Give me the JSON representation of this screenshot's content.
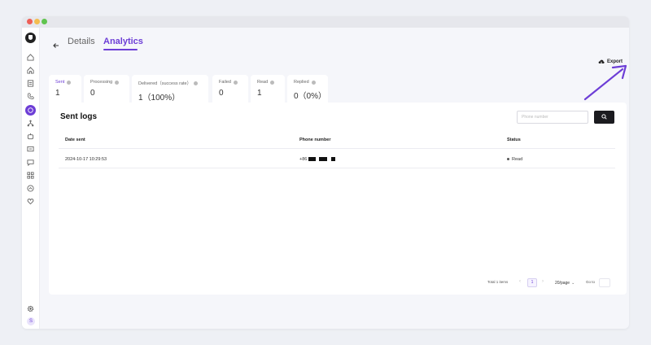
{
  "header": {
    "tab_details": "Details",
    "tab_analytics": "Analytics",
    "export_label": "Export"
  },
  "stats": [
    {
      "label": "Sent",
      "value": "1"
    },
    {
      "label": "Processing",
      "value": "0"
    },
    {
      "label": "Delivered（success rate）",
      "value": "1（100%）"
    },
    {
      "label": "Failed",
      "value": "0"
    },
    {
      "label": "Read",
      "value": "1"
    },
    {
      "label": "Replied",
      "value": "0（0%）"
    }
  ],
  "logs": {
    "title": "Sent logs",
    "search_placeholder": "Phone number",
    "columns": [
      "Date sent",
      "Phone number",
      "Status"
    ],
    "rows": [
      {
        "date": "2024-10-17 10:29:53",
        "phone": "+86",
        "status": "Read"
      }
    ]
  },
  "pagination": {
    "total": "Total 1 items",
    "page": "1",
    "page_size": "20/page",
    "goto": "Go to"
  },
  "sidebar": {
    "avatar": "S"
  },
  "colors": {
    "accent": "#6d3ed6",
    "button_dark": "#1b1b1f",
    "annotation_arrow": "#6d3ed6"
  }
}
